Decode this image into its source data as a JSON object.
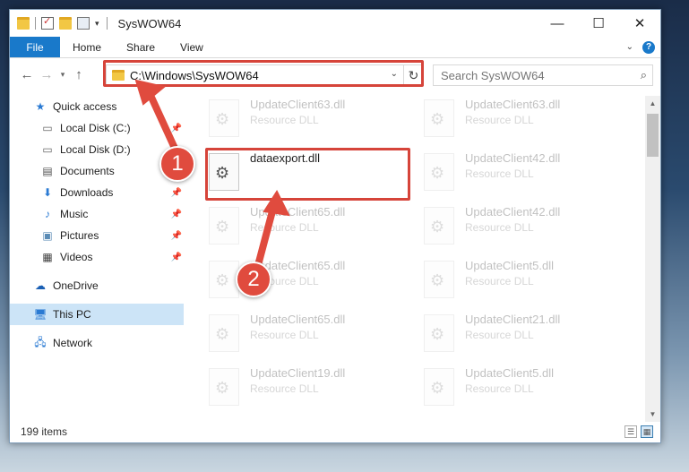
{
  "window": {
    "title": "SysWOW64",
    "controls": {
      "minimize": "—",
      "maximize": "☐",
      "close": "✕"
    }
  },
  "ribbon": {
    "tabs": [
      "File",
      "Home",
      "Share",
      "View"
    ],
    "help": "?"
  },
  "address": {
    "path": "C:\\Windows\\SysWOW64",
    "search_placeholder": "Search SysWOW64"
  },
  "sidebar": {
    "items": [
      {
        "label": "Quick access",
        "icon": "star-icon",
        "pinned": false
      },
      {
        "label": "Local Disk (C:)",
        "icon": "drive-icon",
        "pinned": true
      },
      {
        "label": "Local Disk (D:)",
        "icon": "drive-icon",
        "pinned": false
      },
      {
        "label": "Documents",
        "icon": "document-icon",
        "pinned": false
      },
      {
        "label": "Downloads",
        "icon": "download-icon",
        "pinned": true
      },
      {
        "label": "Music",
        "icon": "music-icon",
        "pinned": true
      },
      {
        "label": "Pictures",
        "icon": "pictures-icon",
        "pinned": true
      },
      {
        "label": "Videos",
        "icon": "videos-icon",
        "pinned": true
      },
      {
        "label": "OneDrive",
        "icon": "cloud-icon",
        "pinned": false
      },
      {
        "label": "This PC",
        "icon": "computer-icon",
        "pinned": false,
        "selected": true
      },
      {
        "label": "Network",
        "icon": "network-icon",
        "pinned": false
      }
    ]
  },
  "files": {
    "col1": [
      {
        "name": "UpdateClient63.dll",
        "type": "Resource DLL"
      },
      {
        "name": "dataexport.dll",
        "type": ""
      },
      {
        "name": "UpdateClient65.dll",
        "type": "Resource DLL"
      },
      {
        "name": "UpdateClient65.dll",
        "type": "Resource DLL"
      },
      {
        "name": "UpdateClient65.dll",
        "type": "Resource DLL"
      },
      {
        "name": "UpdateClient19.dll",
        "type": "Resource DLL"
      }
    ],
    "col2": [
      {
        "name": "UpdateClient63.dll",
        "type": "Resource DLL"
      },
      {
        "name": "UpdateClient42.dll",
        "type": "Resource DLL"
      },
      {
        "name": "UpdateClient42.dll",
        "type": "Resource DLL"
      },
      {
        "name": "UpdateClient5.dll",
        "type": "Resource DLL"
      },
      {
        "name": "UpdateClient21.dll",
        "type": "Resource DLL"
      },
      {
        "name": "UpdateClient5.dll",
        "type": "Resource DLL"
      }
    ]
  },
  "status": {
    "item_count": "199 items"
  },
  "annotations": {
    "step1": "1",
    "step2": "2",
    "color": "#d6443a"
  }
}
